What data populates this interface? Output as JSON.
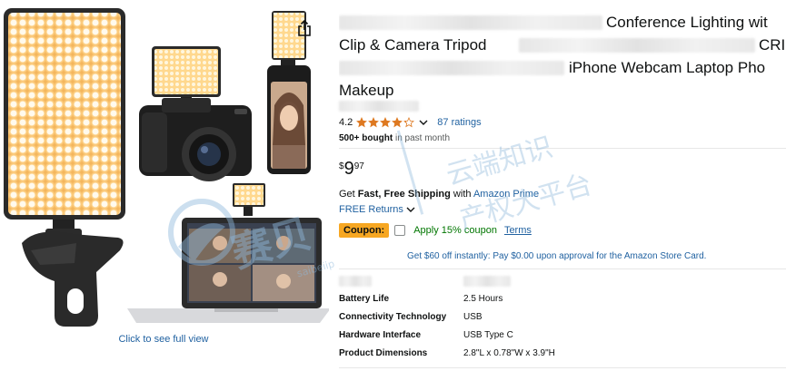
{
  "gallery": {
    "full_view_link": "Click to see full view"
  },
  "title": {
    "line1": "Conference Lighting wit",
    "line2": "Clip & Camera Tripod",
    "line2_end": "CRI",
    "line3": "iPhone Webcam Laptop Pho",
    "line4": "Makeup"
  },
  "rating": {
    "value": "4.2",
    "stars_out_of_5": 4.2,
    "count_label": "87 ratings"
  },
  "bought": {
    "bold": "500+ bought",
    "rest": " in past month"
  },
  "price": {
    "symbol": "$",
    "whole": "9",
    "fraction": "97"
  },
  "shipping": {
    "prefix": "Get ",
    "bold": "Fast, Free Shipping",
    "middle": " with ",
    "prime": "Amazon Prime"
  },
  "returns": {
    "label": "FREE Returns"
  },
  "coupon": {
    "badge": "Coupon:",
    "text": "Apply 15% coupon",
    "terms": "Terms"
  },
  "card_offer": "Get $60 off instantly: Pay $0.00 upon approval for the Amazon Store Card.",
  "specs": [
    {
      "key": "Battery Life",
      "value": "2.5 Hours"
    },
    {
      "key": "Connectivity Technology",
      "value": "USB"
    },
    {
      "key": "Hardware Interface",
      "value": "USB Type C"
    },
    {
      "key": "Product Dimensions",
      "value": "2.8\"L x 0.78\"W x 3.9\"H"
    }
  ],
  "watermark": {
    "logo_text": "赛贝",
    "cn_text_1": "云端知识",
    "cn_text_2": "产权大平台",
    "latin_text": "saibeiip"
  },
  "colors": {
    "link": "#2162a1",
    "star": "#de7921",
    "coupon_badge": "#f7a722",
    "coupon_text": "#007600",
    "watermark": "#8fb9dc"
  }
}
